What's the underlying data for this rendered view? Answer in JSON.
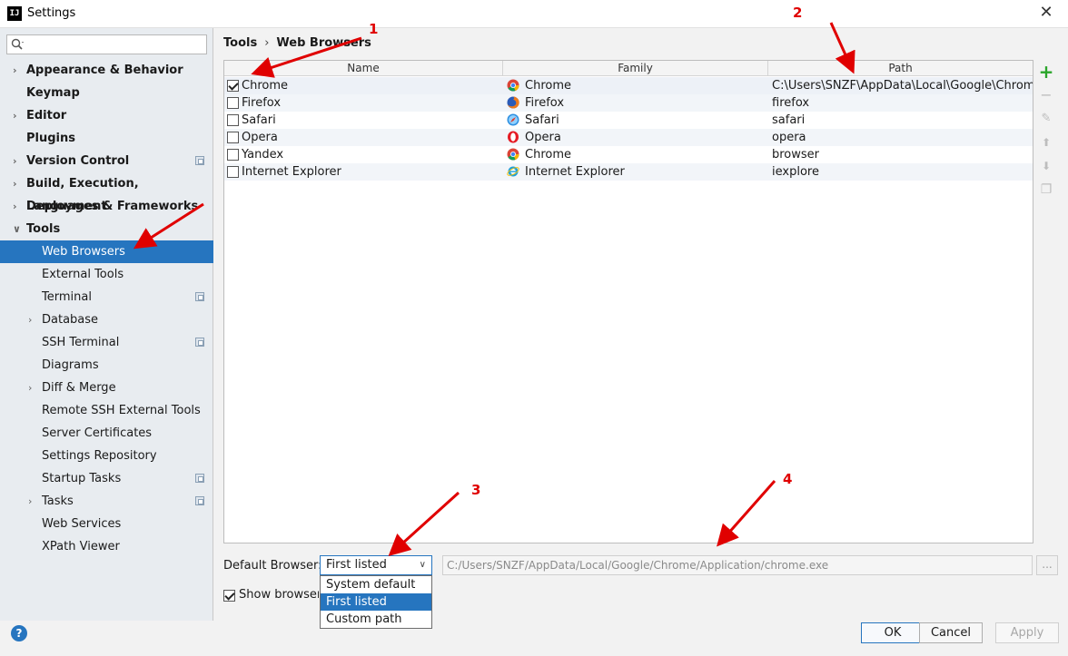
{
  "window": {
    "title": "Settings",
    "app_icon_text": "IJ"
  },
  "sidebar": {
    "search": {
      "placeholder": ""
    },
    "items": [
      {
        "label": "Appearance & Behavior",
        "bold": true,
        "expandable": true,
        "indent": 0
      },
      {
        "label": "Keymap",
        "bold": true,
        "expandable": false,
        "indent": 0
      },
      {
        "label": "Editor",
        "bold": true,
        "expandable": true,
        "indent": 0
      },
      {
        "label": "Plugins",
        "bold": true,
        "expandable": false,
        "indent": 0
      },
      {
        "label": "Version Control",
        "bold": true,
        "expandable": true,
        "indent": 0,
        "project": true
      },
      {
        "label": "Build, Execution, Deployment",
        "bold": true,
        "expandable": true,
        "indent": 0
      },
      {
        "label": "Languages & Frameworks",
        "bold": true,
        "expandable": true,
        "indent": 0
      },
      {
        "label": "Tools",
        "bold": true,
        "expandable": true,
        "expanded": true,
        "indent": 0
      },
      {
        "label": "Web Browsers",
        "indent": 1,
        "selected": true
      },
      {
        "label": "External Tools",
        "indent": 1
      },
      {
        "label": "Terminal",
        "indent": 1,
        "project": true
      },
      {
        "label": "Database",
        "indent": 1,
        "expandable": true
      },
      {
        "label": "SSH Terminal",
        "indent": 1,
        "project": true
      },
      {
        "label": "Diagrams",
        "indent": 1
      },
      {
        "label": "Diff & Merge",
        "indent": 1,
        "expandable": true
      },
      {
        "label": "Remote SSH External Tools",
        "indent": 1
      },
      {
        "label": "Server Certificates",
        "indent": 1
      },
      {
        "label": "Settings Repository",
        "indent": 1
      },
      {
        "label": "Startup Tasks",
        "indent": 1,
        "project": true
      },
      {
        "label": "Tasks",
        "indent": 1,
        "expandable": true,
        "project": true
      },
      {
        "label": "Web Services",
        "indent": 1
      },
      {
        "label": "XPath Viewer",
        "indent": 1
      }
    ]
  },
  "breadcrumb": {
    "parent": "Tools",
    "current": "Web Browsers"
  },
  "table": {
    "headers": {
      "name": "Name",
      "family": "Family",
      "path": "Path"
    },
    "rows": [
      {
        "checked": true,
        "name": "Chrome",
        "family": "Chrome",
        "family_icon": "chrome-icon",
        "path": "C:\\Users\\SNZF\\AppData\\Local\\Google\\Chrome..."
      },
      {
        "checked": false,
        "name": "Firefox",
        "family": "Firefox",
        "family_icon": "firefox-icon",
        "path": "firefox"
      },
      {
        "checked": false,
        "name": "Safari",
        "family": "Safari",
        "family_icon": "safari-icon",
        "path": "safari"
      },
      {
        "checked": false,
        "name": "Opera",
        "family": "Opera",
        "family_icon": "opera-icon",
        "path": "opera"
      },
      {
        "checked": false,
        "name": "Yandex",
        "family": "Chrome",
        "family_icon": "chrome-icon",
        "path": "browser"
      },
      {
        "checked": false,
        "name": "Internet Explorer",
        "family": "Internet Explorer",
        "family_icon": "ie-icon",
        "path": "iexplore"
      }
    ]
  },
  "toolbar": {
    "add": "+",
    "remove": "−",
    "edit": "✎",
    "up": "⬆",
    "down": "⬇",
    "copy": "❐"
  },
  "default_browser": {
    "label": "Default Browser:",
    "selected": "First listed",
    "options": [
      "System default",
      "First listed",
      "Custom path"
    ],
    "path": "C:/Users/SNZF/AppData/Local/Google/Chrome/Application/chrome.exe",
    "browse_label": "..."
  },
  "show_browser": {
    "label": "Show browser popup in the editor",
    "checked": true
  },
  "buttons": {
    "help": "?",
    "ok": "OK",
    "cancel": "Cancel",
    "apply": "Apply"
  },
  "annotations": [
    "1",
    "2",
    "3",
    "4"
  ],
  "colors": {
    "accent": "#2675bf",
    "annotation": "#e00000",
    "add": "#2aa52a"
  }
}
